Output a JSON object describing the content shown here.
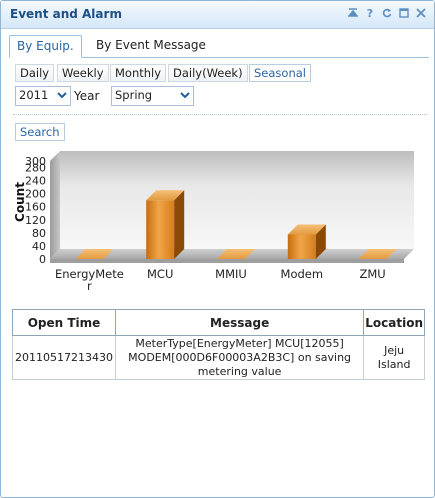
{
  "window": {
    "title": "Event and Alarm"
  },
  "tabs": [
    "By Equip.",
    "By Event Message"
  ],
  "periods": [
    "Daily",
    "Weekly",
    "Monthly",
    "Daily(Week)",
    "Seasonal"
  ],
  "selected_period": "Seasonal",
  "filters": {
    "year_value": "2011",
    "year_label": "Year",
    "season_value": "Spring"
  },
  "search_label": "Search",
  "chart_data": {
    "type": "bar",
    "categories": [
      "EnergyMeter",
      "MCU",
      "MMIU",
      "Modem",
      "ZMU"
    ],
    "values": [
      0,
      180,
      0,
      75,
      0
    ],
    "ylabel": "Count",
    "yticks": [
      0,
      40,
      80,
      120,
      160,
      200,
      240,
      280,
      300
    ],
    "ylim": [
      0,
      300
    ],
    "bar_color": "#d98a2a"
  },
  "table": {
    "headers": [
      "Open Time",
      "Message",
      "Location"
    ],
    "rows": [
      [
        "20110517213430",
        "MeterType[EnergyMeter] MCU[12055] MODEM[000D6F00003A2B3C] on saving metering value",
        "Jeju Island"
      ]
    ]
  }
}
